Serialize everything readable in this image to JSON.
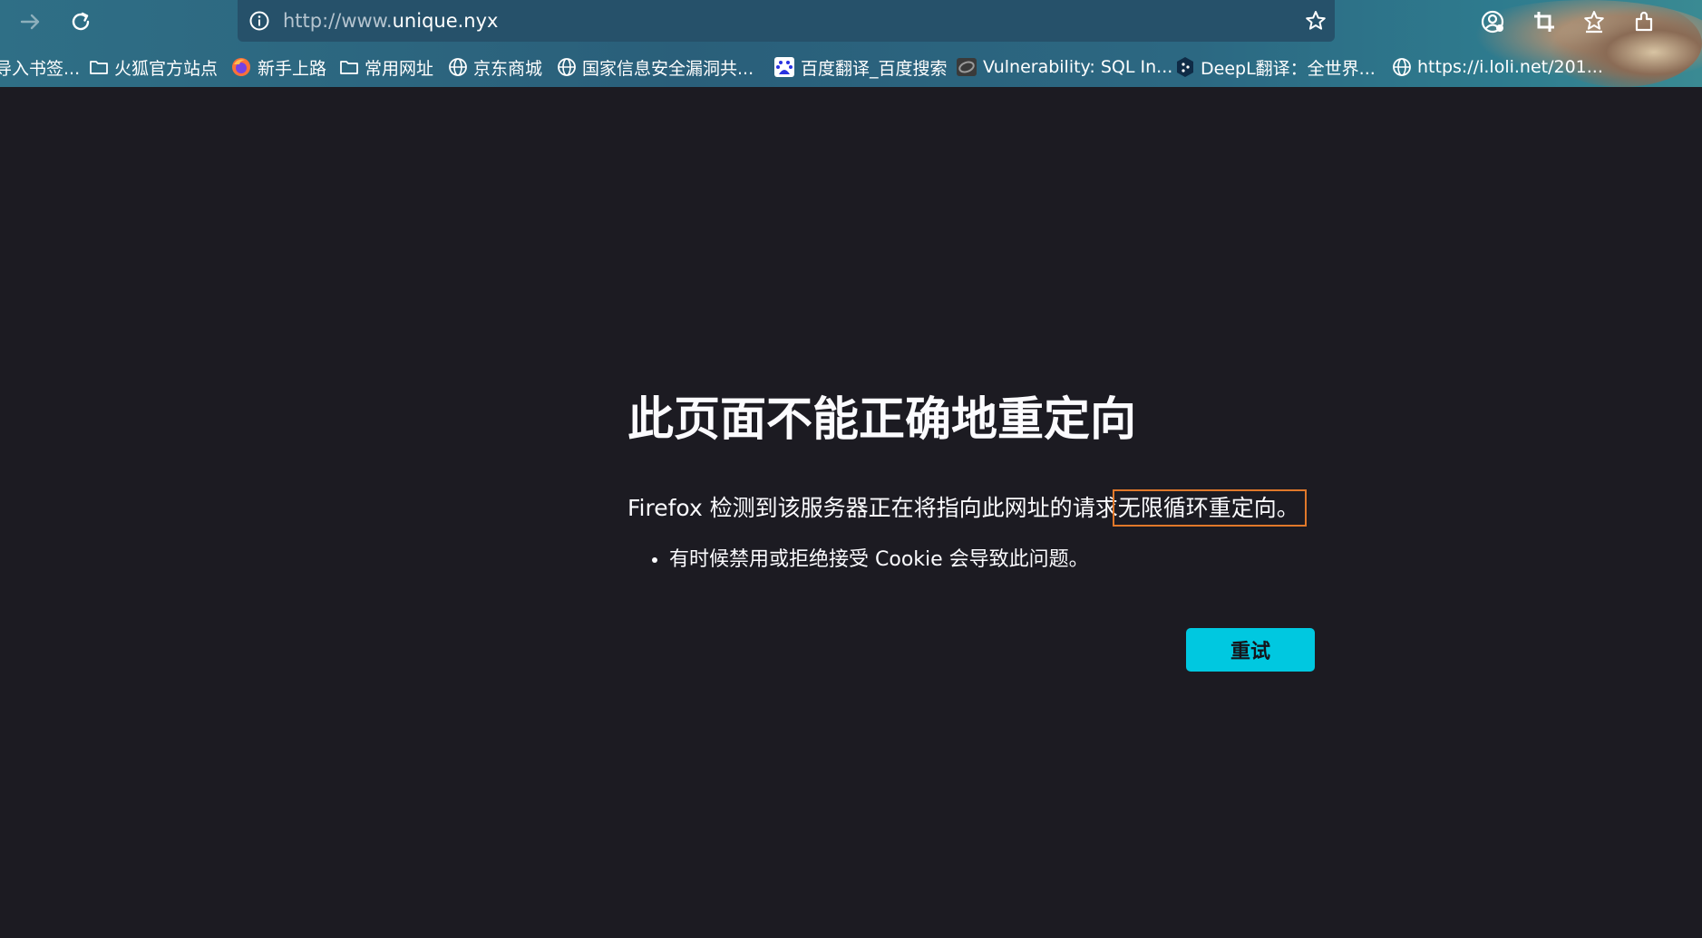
{
  "browser": {
    "url": {
      "scheme_host_prefix": "http://www.",
      "domain": "unique.nyx"
    },
    "nav_icons": [
      "forward-icon",
      "reload-icon",
      "info-icon",
      "star-icon"
    ],
    "toolbar_icons": [
      "account-icon",
      "screenshot-icon",
      "bookmark-icon",
      "extensions-icon"
    ]
  },
  "bookmarks": [
    {
      "label": "导入书签...",
      "icon": "none"
    },
    {
      "label": "火狐官方站点",
      "icon": "folder-icon"
    },
    {
      "label": "新手上路",
      "icon": "firefox-icon"
    },
    {
      "label": "常用网址",
      "icon": "folder-icon"
    },
    {
      "label": "京东商城",
      "icon": "globe-icon"
    },
    {
      "label": "国家信息安全漏洞共...",
      "icon": "globe-icon"
    },
    {
      "label": "百度翻译_百度搜索",
      "icon": "baidu-icon"
    },
    {
      "label": "Vulnerability: SQL In...",
      "icon": "dvwa-icon"
    },
    {
      "label": "DeepL翻译：全世界...",
      "icon": "deepl-icon"
    },
    {
      "label": "https://i.loli.net/201...",
      "icon": "globe-icon"
    }
  ],
  "error": {
    "title": "此页面不能正确地重定向",
    "desc_before": "Firefox 检测到该服务器正在将指向此网址的请求",
    "desc_highlight": "无限循环重定向。",
    "bullets": [
      "有时候禁用或拒绝接受 Cookie 会导致此问题。"
    ],
    "retry_label": "重试"
  },
  "colors": {
    "page_bg": "#1c1b22",
    "text": "#fbfbfe",
    "accent_button": "#00c8e0",
    "highlight_outline": "#e0782a"
  }
}
